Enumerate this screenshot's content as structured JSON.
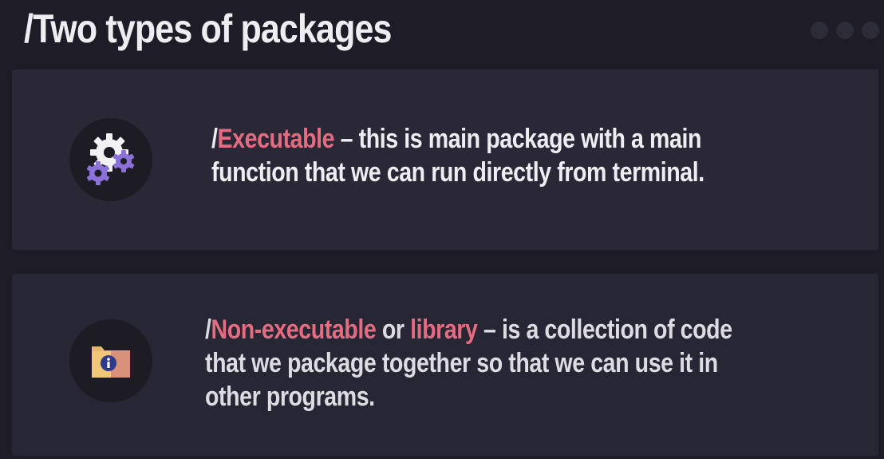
{
  "slide": {
    "title": "/Two types of packages"
  },
  "cards": [
    {
      "icon": "gears-icon",
      "prefix": "/",
      "term": "Executable",
      "line1_rest": " – this is main package with a main",
      "line2": "function that we can run directly from terminal."
    },
    {
      "icon": "info-folder-icon",
      "prefix": "/",
      "term": "Non-executable",
      "connector": " or ",
      "term2": "library",
      "line1_rest": " – is a collection of code",
      "line2": "that we package together so that we can use it in",
      "line3": "other programs."
    }
  ],
  "colors": {
    "background": "#1e1d27",
    "card": "#2a2836",
    "highlight": "#e46c80",
    "text": "#eeeef2"
  }
}
